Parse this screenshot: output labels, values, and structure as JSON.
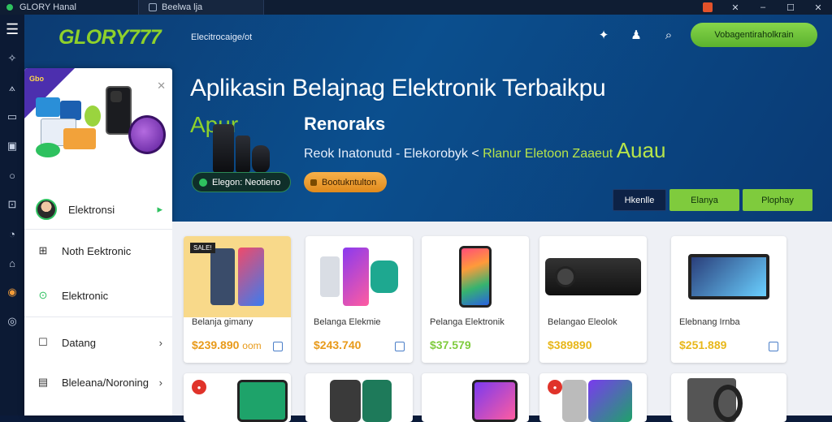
{
  "window": {
    "app_title": "GLORY Hanal",
    "tab_title": "Beelwa lja"
  },
  "header": {
    "logo_text": "GLORY777",
    "nav_link": "Elecitrocaige/ot",
    "cta_label": "Vobagentiraholkrain",
    "icons": [
      "puzzle-icon",
      "bell-icon",
      "search-icon",
      "bookmark-icon"
    ]
  },
  "hero": {
    "title": "Aplikasin Belajnag Elektronik Terbaikpu",
    "sub_green": "Apur",
    "sub_bold": "Renoraks",
    "sub_line_a": "Reok Inatonutd  -  Elekorobyk  <",
    "sub_line_b": "Rlanur  Eletoon  Zaaeut",
    "sub_line_big": "Auau",
    "badge_green": "Elegon: Neotieno",
    "badge_orange": "Bootukntulton",
    "buttons": [
      "Hkenlle",
      "Elanya",
      "Plophay"
    ]
  },
  "panel": {
    "promo_corner": "Gbo",
    "items": [
      {
        "label": "Elektronsi",
        "icon": "avatar"
      },
      {
        "label": "Noth Eektronic",
        "icon": "grid-icon"
      },
      {
        "label": "Elektronic",
        "icon": "map-pin-icon"
      },
      {
        "label": "Datang",
        "icon": "square-icon"
      },
      {
        "label": "Bleleana/Noroning",
        "icon": "list-icon"
      }
    ]
  },
  "products": [
    {
      "name": "Belanja gimany",
      "price": "$239.890",
      "price_suffix": "oom",
      "price_color": "#e89a1a",
      "badge": "SALE!"
    },
    {
      "name": "Belanga Elekmie",
      "price": "$243.740",
      "price_suffix": "",
      "price_color": "#e89a1a",
      "badge": ""
    },
    {
      "name": "Pelanga Elektronik",
      "price": "$37.579",
      "price_suffix": "",
      "price_color": "#7fcb3d",
      "badge": ""
    },
    {
      "name": "Belangao Eleolok",
      "price": "$389890",
      "price_suffix": "",
      "price_color": "#e8b71a",
      "badge": ""
    },
    {
      "name": "Elebnang Irnba",
      "price": "$251.889",
      "price_suffix": "",
      "price_color": "#e8b71a",
      "badge": ""
    }
  ],
  "colors": {
    "accent_green": "#7fcb3d",
    "accent_orange": "#e89a1a",
    "header_blue": "#0b4f8e"
  }
}
